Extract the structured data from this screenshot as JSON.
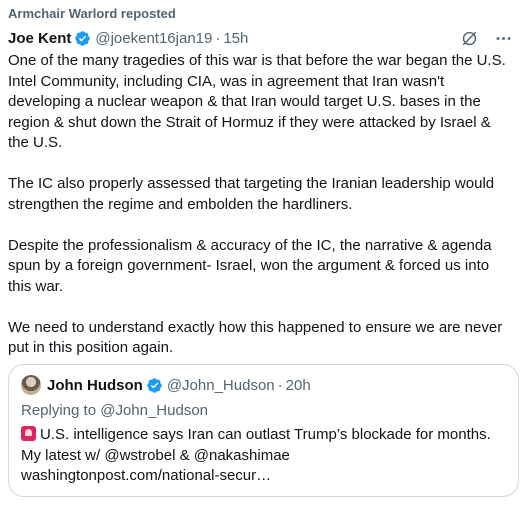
{
  "repost": {
    "text": "Armchair Warlord reposted"
  },
  "author": {
    "name": "Joe Kent",
    "handle": "@joekent16jan19",
    "dot": "·",
    "time": "15h"
  },
  "icons": {
    "verified": "verified-badge-icon",
    "grok": "grok-icon",
    "more": "more-options-icon",
    "siren": "rotating-light-icon"
  },
  "colors": {
    "verified": "#1d9bf0",
    "muted": "#536471",
    "text": "#0f1419",
    "border": "#cfd9de"
  },
  "body": {
    "p1": "One of the many tragedies of this war is that before the war began the U.S. Intel Community, including CIA, was in agreement that Iran wasn't developing a nuclear weapon & that Iran would target U.S. bases in the region & shut down the Strait of Hormuz if they were attacked by Israel & the U.S.",
    "p2": "The IC also properly assessed that targeting the Iranian leadership would strengthen the regime and embolden the hardliners.",
    "p3": "Despite the professionalism & accuracy of the IC, the narrative & agenda spun by a foreign government- Israel, won the argument & forced us into this war.",
    "p4": "We need to understand exactly how this happened to ensure we are never put in this position again."
  },
  "quote": {
    "name": "John Hudson",
    "handle": "@John_Hudson",
    "dot": "·",
    "time": "20h",
    "replying": "Replying to @John_Hudson",
    "line1": "U.S. intelligence says Iran can outlast Trump’s blockade for months.",
    "line2": "My latest w/ @wstrobel & @nakashimae",
    "line3": "washingtonpost.com/national-secur…"
  }
}
